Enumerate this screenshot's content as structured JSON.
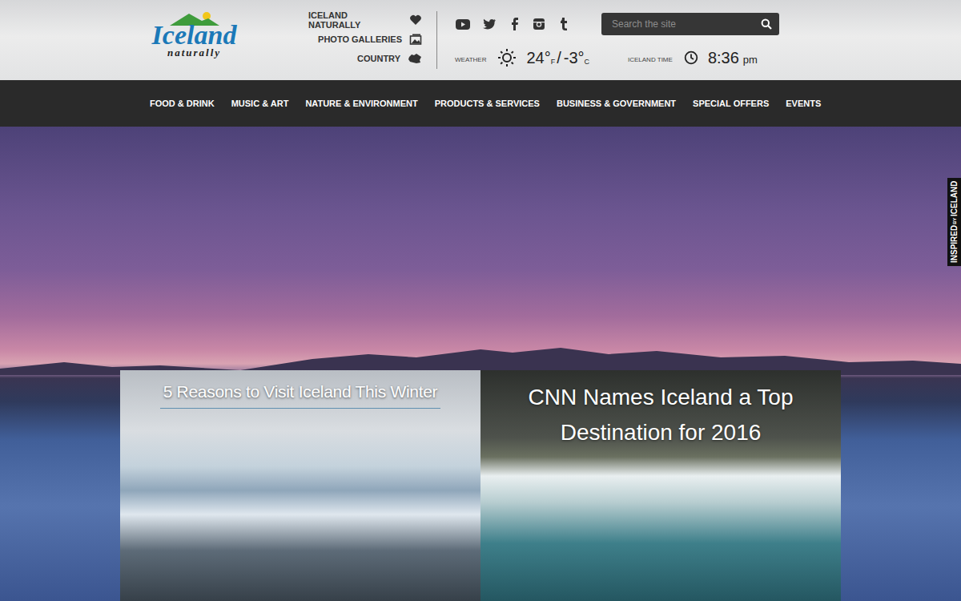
{
  "logo": {
    "name": "Iceland",
    "tagline": "naturally"
  },
  "utility_links": [
    {
      "label": "ICELAND NATURALLY"
    },
    {
      "label": "PHOTO GALLERIES"
    },
    {
      "label": "COUNTRY"
    }
  ],
  "weather": {
    "label": "WEATHER",
    "fahrenheit": "24°",
    "f_unit": "F",
    "separator": "/",
    "celsius": "-3°",
    "c_unit": "C"
  },
  "time": {
    "label": "ICELAND TIME",
    "value": "8:36",
    "period": "pm"
  },
  "search": {
    "placeholder": "Search the site"
  },
  "nav": [
    {
      "label": "FOOD & DRINK"
    },
    {
      "label": "MUSIC & ART"
    },
    {
      "label": "NATURE & ENVIRONMENT"
    },
    {
      "label": "PRODUCTS & SERVICES"
    },
    {
      "label": "BUSINESS & GOVERNMENT"
    },
    {
      "label": "SPECIAL OFFERS"
    },
    {
      "label": "EVENTS"
    }
  ],
  "side_tab": {
    "first": "INSPIRED",
    "middle": "BY",
    "last": "ICELAND"
  },
  "cards": [
    {
      "title": "5 Reasons to Visit Iceland This Winter",
      "kind": "underlined"
    },
    {
      "title": "CNN Names Iceland a Top Destination for 2016",
      "kind": "headline"
    }
  ]
}
